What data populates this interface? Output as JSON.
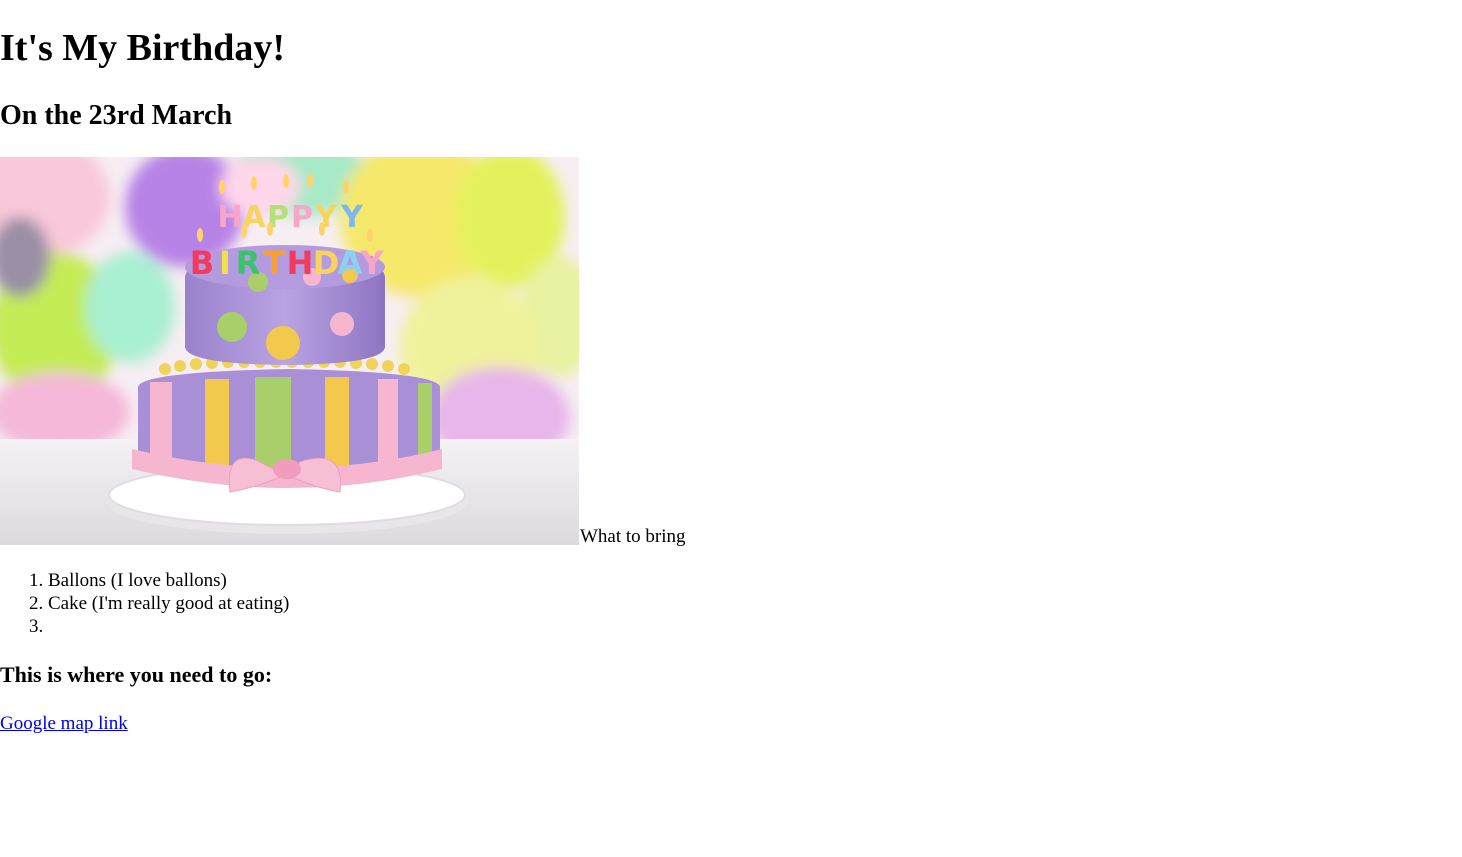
{
  "page": {
    "title": "It's My Birthday!",
    "subtitle": "On the 23rd March"
  },
  "image": {
    "alt": "Birthday cake"
  },
  "bring": {
    "label": "What to bring",
    "items": [
      "Ballons (I love ballons)",
      "Cake (I'm really good at eating)",
      ""
    ]
  },
  "location": {
    "heading": "This is where you need to go:",
    "link_text": "Google map link"
  },
  "colors": {
    "link": "#0000ee",
    "cake_purple": "#a98fd6",
    "cake_pink": "#f6b6cf",
    "cake_yellow": "#f3c94d",
    "cake_green": "#a8cf6a"
  }
}
